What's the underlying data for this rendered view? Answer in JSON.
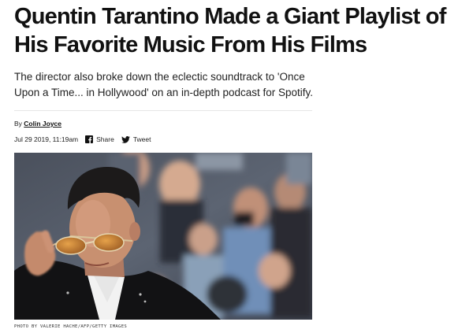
{
  "article": {
    "headline": "Quentin Tarantino Made a Giant Playlist of His Favorite Music From His Films",
    "dek": "The director also broke down the eclectic soundtrack to 'Once Upon a Time... in Hollywood' on an in-depth podcast for Spotify.",
    "byline_prefix": "By",
    "author": "Colin Joyce",
    "date": "Jul 29 2019, 11:19am",
    "share_label": "Share",
    "tweet_label": "Tweet",
    "photo_credit": "PHOTO BY VALERIE HACHE/AFP/GETTY IMAGES",
    "facebook_icon": "facebook-icon",
    "twitter_icon": "twitter-icon"
  }
}
